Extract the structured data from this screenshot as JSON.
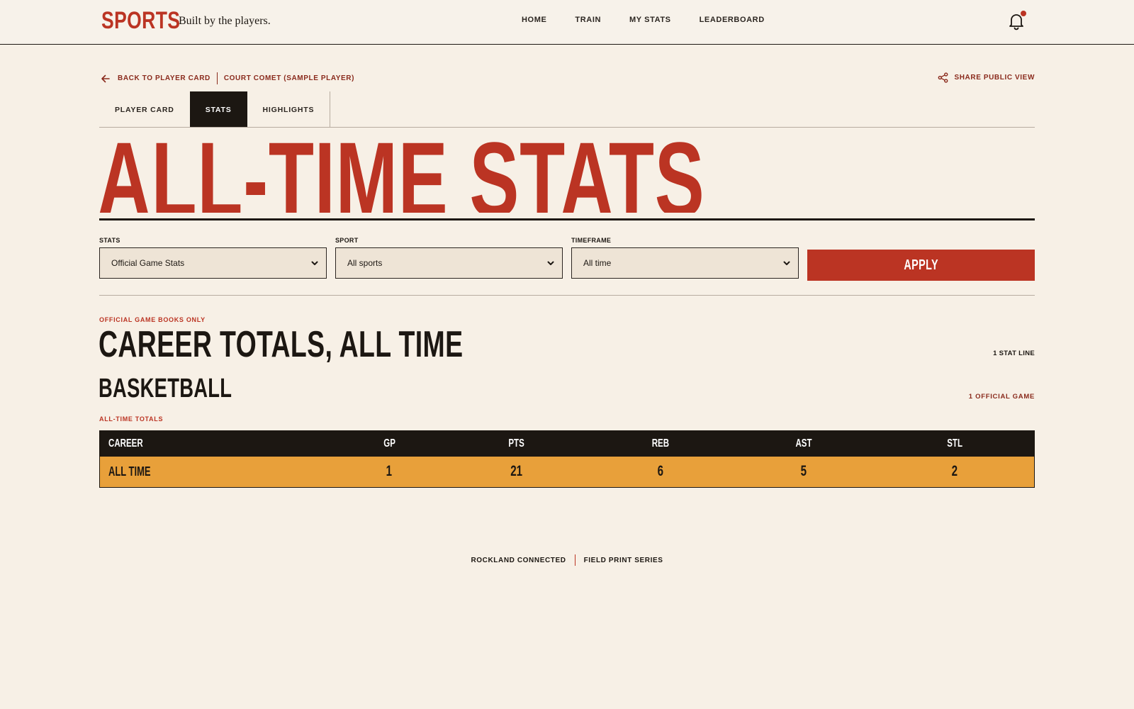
{
  "brand": {
    "logo": "SPORTS",
    "tagline": "Built by the players."
  },
  "nav": {
    "items": [
      "HOME",
      "TRAIN",
      "MY STATS",
      "LEADERBOARD"
    ]
  },
  "notifications": {
    "icon": "bell-icon",
    "has_unread": true
  },
  "breadcrumb": {
    "back_label": "BACK TO PLAYER CARD",
    "player_label": "COURT COMET (SAMPLE PLAYER)"
  },
  "share": {
    "label": "SHARE PUBLIC VIEW"
  },
  "tabs": [
    {
      "label": "PLAYER CARD",
      "active": false
    },
    {
      "label": "STATS",
      "active": true
    },
    {
      "label": "HIGHLIGHTS",
      "active": false
    }
  ],
  "page": {
    "title": "ALL-TIME STATS"
  },
  "filters": {
    "stats": {
      "label": "STATS",
      "value": "Official Game Stats"
    },
    "sport": {
      "label": "SPORT",
      "value": "All sports"
    },
    "timeframe": {
      "label": "TIMEFRAME",
      "value": "All time"
    },
    "apply_label": "APPLY"
  },
  "career": {
    "kicker": "OFFICIAL GAME BOOKS ONLY",
    "heading": "CAREER TOTALS, ALL TIME",
    "stat_line_count": "1 STAT LINE",
    "sport_heading": "BASKETBALL",
    "games_count": "1 OFFICIAL GAME",
    "totals_label": "ALL-TIME TOTALS",
    "table": {
      "columns": [
        "CAREER",
        "GP",
        "PTS",
        "REB",
        "AST",
        "STL"
      ],
      "rows": [
        [
          "ALL TIME",
          "1",
          "21",
          "6",
          "5",
          "2"
        ]
      ]
    }
  },
  "footer": {
    "left": "ROCKLAND CONNECTED",
    "right": "FIELD PRINT SERIES"
  },
  "colors": {
    "accent": "#bb3423",
    "ink": "#1c1712",
    "background": "#f7f0e6",
    "highlight_row": "#e8a03a"
  }
}
